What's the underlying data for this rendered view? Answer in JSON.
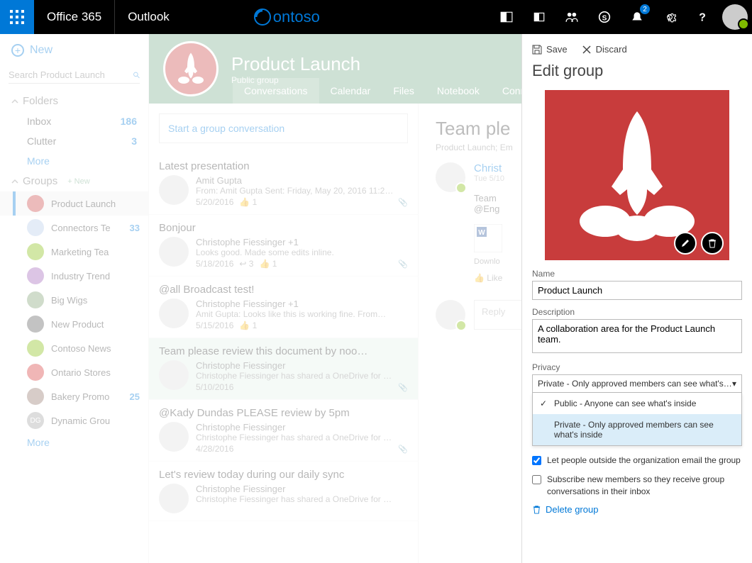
{
  "topbar": {
    "suite": "Office 365",
    "app": "Outlook",
    "brand": "ontoso",
    "notif_count": "2"
  },
  "sidebar": {
    "new_label": "New",
    "search_placeholder": "Search Product Launch",
    "folders_label": "Folders",
    "folders": [
      {
        "name": "Inbox",
        "count": "186"
      },
      {
        "name": "Clutter",
        "count": "3"
      }
    ],
    "more": "More",
    "groups_label": "Groups",
    "groups_new": "+ New",
    "groups": [
      {
        "name": "Product Launch",
        "count": "",
        "color": "#c83c3c",
        "sel": true
      },
      {
        "name": "Connectors Te",
        "count": "33",
        "color": "#b3c9e8"
      },
      {
        "name": "Marketing Tea",
        "count": "",
        "color": "#7fba00"
      },
      {
        "name": "Industry Trend",
        "count": "",
        "color": "#9b59b6"
      },
      {
        "name": "Big Wigs",
        "count": "",
        "color": "#7a9b6c"
      },
      {
        "name": "New Product",
        "count": "",
        "color": "#555"
      },
      {
        "name": "Contoso News",
        "count": "",
        "color": "#7fba00"
      },
      {
        "name": "Ontario Stores",
        "count": "",
        "color": "#d32f2f"
      },
      {
        "name": "Bakery Promo",
        "count": "25",
        "color": "#8d6e63"
      },
      {
        "name": "Dynamic Grou",
        "count": "",
        "color": "#9e9e9e",
        "initials": "DG"
      }
    ]
  },
  "group_header": {
    "title": "Product Launch",
    "subtitle": "Public group",
    "tabs": [
      "Conversations",
      "Calendar",
      "Files",
      "Notebook",
      "Connec"
    ]
  },
  "compose": "Start a group conversation",
  "messages": [
    {
      "title": "Latest presentation",
      "from": "Amit Gupta",
      "preview": "From: Amit Gupta Sent: Friday, May 20, 2016 11:2…",
      "date": "5/20/2016",
      "like": "1",
      "att": true
    },
    {
      "title": "Bonjour",
      "from": "Christophe Fiessinger +1",
      "preview": "Looks good. Made some edits inline.",
      "date": "5/18/2016",
      "reply": "3",
      "like": "1",
      "att": true
    },
    {
      "title": "@all Broadcast test!",
      "from": "Christophe Fiessinger +1",
      "preview": "Amit Gupta:  Looks like this is working fine.  From…",
      "date": "5/15/2016",
      "like": "1",
      "att": false
    },
    {
      "title": "Team please review this document by noo…",
      "from": "Christophe Fiessinger",
      "preview": "Christophe Fiessinger has shared a OneDrive for …",
      "date": "5/10/2016",
      "att": true,
      "sel": true
    },
    {
      "title": "@Kady Dundas PLEASE review by 5pm",
      "from": "Christophe Fiessinger",
      "preview": "Christophe Fiessinger has shared a OneDrive for …",
      "date": "4/28/2016",
      "att": true
    },
    {
      "title": "Let's review today during our daily sync",
      "from": "Christophe Fiessinger",
      "preview": "Christophe Fiessinger has shared a OneDrive for …",
      "date": "",
      "att": false
    }
  ],
  "preview": {
    "title": "Team ple",
    "sub": "Product Launch; Em",
    "from": "Christ",
    "date": "Tue 5/10",
    "body1": "Team",
    "body2": "@Eng",
    "download": "Downlo",
    "like": "Like",
    "reply": "Reply "
  },
  "panel": {
    "save": "Save",
    "discard": "Discard",
    "title": "Edit group",
    "name_label": "Name",
    "name_value": "Product Launch",
    "desc_label": "Description",
    "desc_value": "A collaboration area for the Product Launch team.",
    "privacy_label": "Privacy",
    "privacy_value": "Private - Only approved members can see what's inside",
    "opt_public": "Public - Anyone can see what's inside",
    "opt_private": "Private - Only approved members can see what's inside",
    "check1": "Let people outside the organization email the group",
    "check2": "Subscribe new members so they receive group conversations in their inbox",
    "delete": "Delete group"
  }
}
